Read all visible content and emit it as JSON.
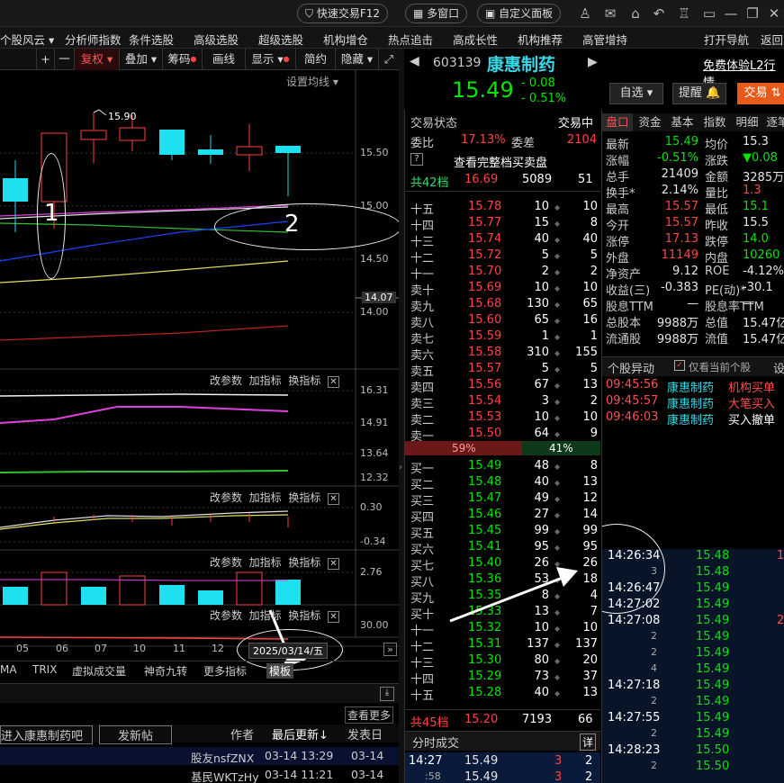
{
  "topbar": {
    "quick_trade": "快速交易F12",
    "multi_window": "多窗口",
    "custom_panel": "自定义面板"
  },
  "menu": [
    "个股风云 ▾",
    "分析师指数",
    "条件选股",
    "高级选股",
    "超级选股",
    "机构增仓",
    "热点追击",
    "高成长性",
    "机构推荐",
    "高管增持",
    "打开导航",
    "返回"
  ],
  "chart_toolbar": [
    "+",
    "一",
    "复权 ▾",
    "叠加 ▾",
    "筹码",
    "画线",
    "显示 ▾",
    "简约",
    "隐藏 ▾",
    "⤢"
  ],
  "ma_settings": "设置均线 ▾",
  "price_axis": [
    "15.50",
    "15.00",
    "14.50",
    "14.07",
    "14.00"
  ],
  "annotations": {
    "label1": "1",
    "label2": "2",
    "high_marker": "15.90"
  },
  "indicator_tools": {
    "param": "改参数",
    "add": "加指标",
    "swap": "换指标",
    "close": "✕"
  },
  "ind1_axis": [
    "16.31",
    "14.91",
    "13.64",
    "12.32"
  ],
  "ind2_axis": [
    "0.30",
    "-0.34"
  ],
  "ind3_axis": [
    "2.76"
  ],
  "ind4_axis": [
    "30.00"
  ],
  "date_axis": [
    "05",
    "06",
    "07",
    "10",
    "11",
    "12"
  ],
  "current_date": "2025/03/14/五",
  "bottom_tabs": [
    "MA",
    "TRIX",
    "虚拟成交量",
    "神奇九转",
    "更多指标",
    "模板"
  ],
  "forum": {
    "view_more": "查看更多",
    "join": "进入康惠制药吧",
    "post": "发新帖",
    "author": "作者",
    "last_update": "最后更新",
    "publish": "发表日",
    "rows": [
      {
        "user": "股友nsfZNX",
        "time": "03-14 13:29",
        "date": "03-14"
      },
      {
        "user": "基民WKTzHy",
        "time": "03-14 11:21",
        "date": "03-14"
      }
    ]
  },
  "stock": {
    "code": "603139",
    "name": "康惠制药",
    "price": "15.49",
    "change": "- 0.08",
    "pct": "- 0.51%",
    "free_l2": "免费体验L2行情",
    "watch": "自选 ▾",
    "remind": "提醒",
    "trade": "交易"
  },
  "orderbook": {
    "status_label": "交易状态",
    "status": "交易中",
    "wb_label": "委比",
    "wb": "17.13%",
    "wc_label": "委差",
    "wc": "2104",
    "full_btn": "查看完整档买卖盘",
    "ask_total": {
      "label": "共42档",
      "price": "16.69",
      "vol": "5089",
      "n": "51"
    },
    "asks": [
      [
        "十五",
        "15.78",
        "10",
        "10"
      ],
      [
        "十四",
        "15.77",
        "15",
        "8"
      ],
      [
        "十三",
        "15.74",
        "40",
        "40"
      ],
      [
        "十二",
        "15.72",
        "5",
        "5"
      ],
      [
        "十一",
        "15.70",
        "2",
        "2"
      ],
      [
        "卖十",
        "15.69",
        "10",
        "10"
      ],
      [
        "卖九",
        "15.68",
        "130",
        "65"
      ],
      [
        "卖八",
        "15.60",
        "65",
        "16"
      ],
      [
        "卖七",
        "15.59",
        "1",
        "1"
      ],
      [
        "卖六",
        "15.58",
        "310",
        "155"
      ],
      [
        "卖五",
        "15.57",
        "5",
        "5"
      ],
      [
        "卖四",
        "15.56",
        "67",
        "13"
      ],
      [
        "卖三",
        "15.54",
        "3",
        "2"
      ],
      [
        "卖二",
        "15.53",
        "10",
        "10"
      ],
      [
        "卖一",
        "15.50",
        "64",
        "9"
      ]
    ],
    "ratio_sell": "59%",
    "ratio_buy": "41%",
    "bids": [
      [
        "买一",
        "15.49",
        "48",
        "8"
      ],
      [
        "买二",
        "15.48",
        "40",
        "13"
      ],
      [
        "买三",
        "15.47",
        "49",
        "12"
      ],
      [
        "买四",
        "15.46",
        "27",
        "14"
      ],
      [
        "买五",
        "15.45",
        "99",
        "99"
      ],
      [
        "买六",
        "15.41",
        "95",
        "95"
      ],
      [
        "买七",
        "15.40",
        "26",
        "26"
      ],
      [
        "买八",
        "15.36",
        "53",
        "18"
      ],
      [
        "买九",
        "15.35",
        "8",
        "4"
      ],
      [
        "买十",
        "15.33",
        "13",
        "7"
      ],
      [
        "十一",
        "15.32",
        "10",
        "10"
      ],
      [
        "十二",
        "15.31",
        "137",
        "137"
      ],
      [
        "十三",
        "15.30",
        "80",
        "20"
      ],
      [
        "十四",
        "15.29",
        "73",
        "37"
      ],
      [
        "十五",
        "15.28",
        "40",
        "13"
      ]
    ],
    "bid_total": {
      "label": "共45档",
      "price": "15.20",
      "vol": "7193",
      "n": "66"
    },
    "tick_title": "分时成交",
    "tick_btn": "详",
    "ticks": [
      [
        "14:27",
        "15.49",
        "3",
        "2"
      ],
      [
        ":58",
        "15.49",
        "3",
        "2"
      ]
    ]
  },
  "right_tabs": [
    "盘口",
    "资金",
    "基本",
    "指数",
    "明细",
    "逐笔"
  ],
  "quote": [
    [
      "最新",
      "15.49",
      "均价",
      "15.3"
    ],
    [
      "涨幅",
      "-0.51%",
      "涨跌",
      "▼0.08"
    ],
    [
      "总手",
      "21409",
      "金额",
      "3285万"
    ],
    [
      "换手*",
      "2.14%",
      "量比",
      "1.3"
    ],
    [
      "最高",
      "15.57",
      "最低",
      "15.1"
    ],
    [
      "今开",
      "15.57",
      "昨收",
      "15.5"
    ],
    [
      "涨停",
      "17.13",
      "跌停",
      "14.0"
    ],
    [
      "外盘",
      "11149",
      "内盘",
      "10260"
    ],
    [
      "净资产",
      "9.12",
      "ROE",
      "-4.12%"
    ],
    [
      "收益(三)",
      "-0.383",
      "PE(动)*",
      "-30.1"
    ],
    [
      "股息TTM",
      "—",
      "股息率TTM",
      "—"
    ],
    [
      "总股本",
      "9988万",
      "总值",
      "15.47亿"
    ],
    [
      "流通股",
      "9988万",
      "流值",
      "15.47亿"
    ]
  ],
  "movement": {
    "title": "个股异动",
    "only_current": "仅看当前个股",
    "settings": "设",
    "rows": [
      [
        "09:45:56",
        "康惠制药",
        "机构买单"
      ],
      [
        "09:45:57",
        "康惠制药",
        "大笔买入"
      ],
      [
        "09:46:03",
        "康惠制药",
        "买入撤单"
      ]
    ]
  },
  "trades": [
    [
      "14:26:34",
      "15.48",
      "1"
    ],
    [
      "3",
      "15.48",
      ""
    ],
    [
      "14:26:47",
      "15.49",
      ""
    ],
    [
      "14:27:02",
      "15.49",
      ""
    ],
    [
      "14:27:08",
      "15.49",
      "2"
    ],
    [
      "2",
      "15.49",
      ""
    ],
    [
      "2",
      "15.49",
      ""
    ],
    [
      "4",
      "15.49",
      ""
    ],
    [
      "14:27:18",
      "15.49",
      ""
    ],
    [
      "2",
      "15.49",
      ""
    ],
    [
      "14:27:55",
      "15.49",
      ""
    ],
    [
      "2",
      "15.49",
      ""
    ],
    [
      "14:28:23",
      "15.50",
      ""
    ],
    [
      "2",
      "15.50",
      ""
    ]
  ]
}
